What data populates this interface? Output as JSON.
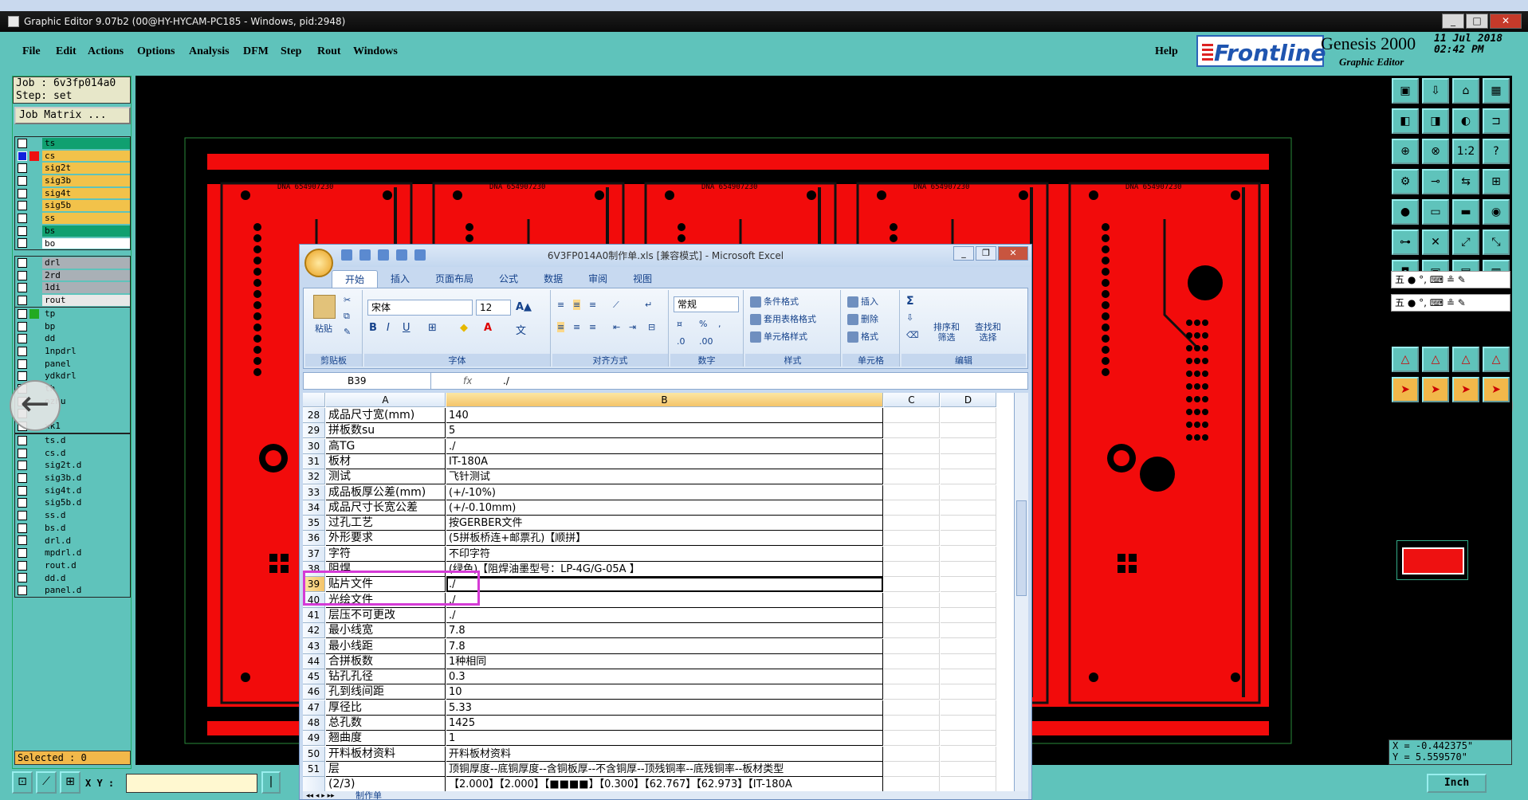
{
  "window": {
    "outer_title": "",
    "title": "Graphic Editor 9.07b2 (00@HY-HYCAM-PC185 - Windows, pid:2948)",
    "controls": [
      "_",
      "□",
      "✕"
    ]
  },
  "menu": [
    "File",
    "Edit",
    "Actions",
    "Options",
    "Analysis",
    "DFM",
    "Step",
    "Rout",
    "Windows"
  ],
  "help": "Help",
  "brand": {
    "logo": "Frontline",
    "product": "Genesis 2000",
    "subtitle": "Graphic Editor",
    "date": "11 Jul 2018",
    "time": "02:42 PM"
  },
  "job": {
    "job_line": "Job : 6v3fp014a0",
    "step_line": "Step: set",
    "matrix_button": "Job Matrix ..."
  },
  "layers_group1": [
    {
      "name": "ts",
      "color": "#10a070"
    },
    {
      "name": "cs",
      "color": "#f2c24a",
      "active": true
    },
    {
      "name": "sig2t",
      "color": "#f2c24a"
    },
    {
      "name": "sig3b",
      "color": "#f2c24a"
    },
    {
      "name": "sig4t",
      "color": "#f2c24a"
    },
    {
      "name": "sig5b",
      "color": "#f2c24a"
    },
    {
      "name": "ss",
      "color": "#f2c24a"
    },
    {
      "name": "bs",
      "color": "#10a070"
    },
    {
      "name": "bo",
      "color": "#ffffff"
    }
  ],
  "layers_group2": [
    {
      "name": "drl",
      "color": "#a9b0b6"
    },
    {
      "name": "2rd",
      "color": "#a9b0b6"
    },
    {
      "name": "1di",
      "color": "#a9b0b6"
    },
    {
      "name": "rout",
      "color": "#e8e8e8"
    }
  ],
  "layers_group3": [
    {
      "name": "tp",
      "color": "#5fc3bb",
      "mark": true
    },
    {
      "name": "bp",
      "color": "#5fc3bb"
    },
    {
      "name": "dd",
      "color": "#5fc3bb"
    },
    {
      "name": "1npdrl",
      "color": "#5fc3bb"
    },
    {
      "name": "panel",
      "color": "#5fc3bb"
    },
    {
      "name": "ydkdrl",
      "color": "#5fc3bb"
    },
    {
      "name": "th",
      "color": "#5fc3bb"
    },
    {
      "name": "ozhu",
      "color": "#5fc3bb"
    },
    {
      "name": "",
      "color": "#5fc3bb"
    },
    {
      "name": "xk1",
      "color": "#5fc3bb"
    }
  ],
  "layers_group4": [
    {
      "name": "ts.d",
      "color": "#5fc3bb"
    },
    {
      "name": "cs.d",
      "color": "#5fc3bb"
    },
    {
      "name": "sig2t.d",
      "color": "#5fc3bb"
    },
    {
      "name": "sig3b.d",
      "color": "#5fc3bb"
    },
    {
      "name": "sig4t.d",
      "color": "#5fc3bb"
    },
    {
      "name": "sig5b.d",
      "color": "#5fc3bb"
    },
    {
      "name": "ss.d",
      "color": "#5fc3bb"
    },
    {
      "name": "bs.d",
      "color": "#5fc3bb"
    },
    {
      "name": "drl.d",
      "color": "#5fc3bb"
    },
    {
      "name": "mpdrl.d",
      "color": "#5fc3bb"
    },
    {
      "name": "rout.d",
      "color": "#5fc3bb"
    },
    {
      "name": "dd.d",
      "color": "#5fc3bb"
    },
    {
      "name": "panel.d",
      "color": "#5fc3bb"
    }
  ],
  "selected": "Selected : 0",
  "coords": {
    "x": "X = -0.442375\"",
    "y": "Y =  5.559570\""
  },
  "bottom": {
    "xy_label": "X Y :",
    "xy_value": "",
    "units": "Inch"
  },
  "board": {
    "part_label": "DNA 654907230",
    "copies": 5
  },
  "ime": {
    "row1": "五 ● °, ⌨ ≗ ✎",
    "row2": "五 ● °, ⌨ ≗ ✎"
  },
  "excel": {
    "title": "6V3FP014A0制作单.xls [兼容模式] - Microsoft Excel",
    "tabs": [
      "开始",
      "插入",
      "页面布局",
      "公式",
      "数据",
      "审阅",
      "视图"
    ],
    "active_tab": 0,
    "ribbon": {
      "clipboard": "剪贴板",
      "paste": "粘贴",
      "font_group": "字体",
      "font_name": "宋体",
      "font_size": "12",
      "align_group": "对齐方式",
      "number_group": "数字",
      "number_format": "常规",
      "percent": "%",
      "style_group": "样式",
      "cond_format": "条件格式",
      "table_format": "套用表格格式",
      "cell_style": "单元格样式",
      "cells_group": "单元格",
      "insert": "插入",
      "delete": "删除",
      "format": "格式",
      "edit_group": "编辑",
      "sort": "排序和\n筛选",
      "find": "查找和\n选择"
    },
    "name_box": "B39",
    "formula": "./",
    "columns": [
      "A",
      "B",
      "C",
      "D"
    ],
    "rows": [
      {
        "n": "28",
        "a": "成品尺寸宽(mm)",
        "b": "140"
      },
      {
        "n": "29",
        "a": "拼板数su",
        "b": "5"
      },
      {
        "n": "30",
        "a": "高TG",
        "b": "./"
      },
      {
        "n": "31",
        "a": "板材",
        "b": "IT-180A"
      },
      {
        "n": "32",
        "a": "测试",
        "b": "飞针测试"
      },
      {
        "n": "33",
        "a": "成品板厚公差(mm)",
        "b": "(+/-10%)"
      },
      {
        "n": "34",
        "a": "成品尺寸长宽公差",
        "b": "(+/-0.10mm)"
      },
      {
        "n": "35",
        "a": "过孔工艺",
        "b": "按GERBER文件"
      },
      {
        "n": "36",
        "a": "外形要求",
        "b": "(5拼板桥连+邮票孔)【顺拼】"
      },
      {
        "n": "37",
        "a": "字符",
        "b": "不印字符"
      },
      {
        "n": "38",
        "a": "阻焊",
        "b": "(绿色)【阻焊油墨型号：LP-4G/G-05A 】"
      },
      {
        "n": "39",
        "a": "贴片文件",
        "b": "./",
        "sel": true
      },
      {
        "n": "40",
        "a": "光绘文件",
        "b": "./"
      },
      {
        "n": "41",
        "a": "层压不可更改",
        "b": "./"
      },
      {
        "n": "42",
        "a": "最小线宽",
        "b": "7.8"
      },
      {
        "n": "43",
        "a": "最小线距",
        "b": "7.8"
      },
      {
        "n": "44",
        "a": "合拼板数",
        "b": "1种相同"
      },
      {
        "n": "45",
        "a": "钻孔孔径",
        "b": "0.3"
      },
      {
        "n": "46",
        "a": "孔到线间距",
        "b": "10"
      },
      {
        "n": "47",
        "a": "厚径比",
        "b": "5.33"
      },
      {
        "n": "48",
        "a": "总孔数",
        "b": "1425"
      },
      {
        "n": "49",
        "a": "翘曲度",
        "b": "1"
      },
      {
        "n": "50",
        "a": "开料板材资料",
        "b": "开料板材资料"
      },
      {
        "n": "51",
        "a": "层",
        "b": "顶铜厚度--底铜厚度--含铜板厚--不含铜厚--顶残铜率--底残铜率--板材类型"
      },
      {
        "n": "",
        "a": "(2/3)",
        "b": "【2.000】【2.000】【■■■■】【0.300】【62.767】【62.973】【IT-180A"
      }
    ],
    "sheet_tab": "制作单"
  }
}
